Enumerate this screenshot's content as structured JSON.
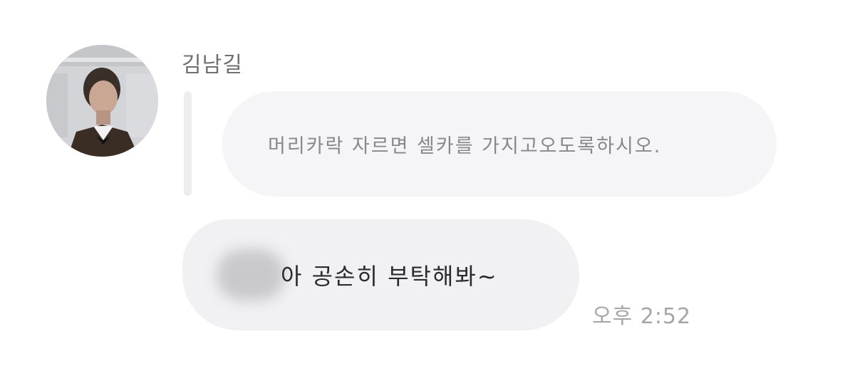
{
  "chat": {
    "sender": {
      "name": "김남길",
      "avatar_icon": "profile-photo"
    },
    "reply_quote": {
      "text": "머리카락 자르면 셀카를 가지고오도록하시오."
    },
    "message": {
      "text": "아 공손히 부탁해봐~",
      "time": "오후 2:52"
    }
  },
  "colors": {
    "background": "#ffffff",
    "bubble": "#f1f1f3",
    "quote_bubble": "#f5f5f7",
    "name_text": "#707070",
    "quote_text": "#888888",
    "message_text": "#2b2b2b",
    "timestamp_text": "#a6a6a6"
  }
}
